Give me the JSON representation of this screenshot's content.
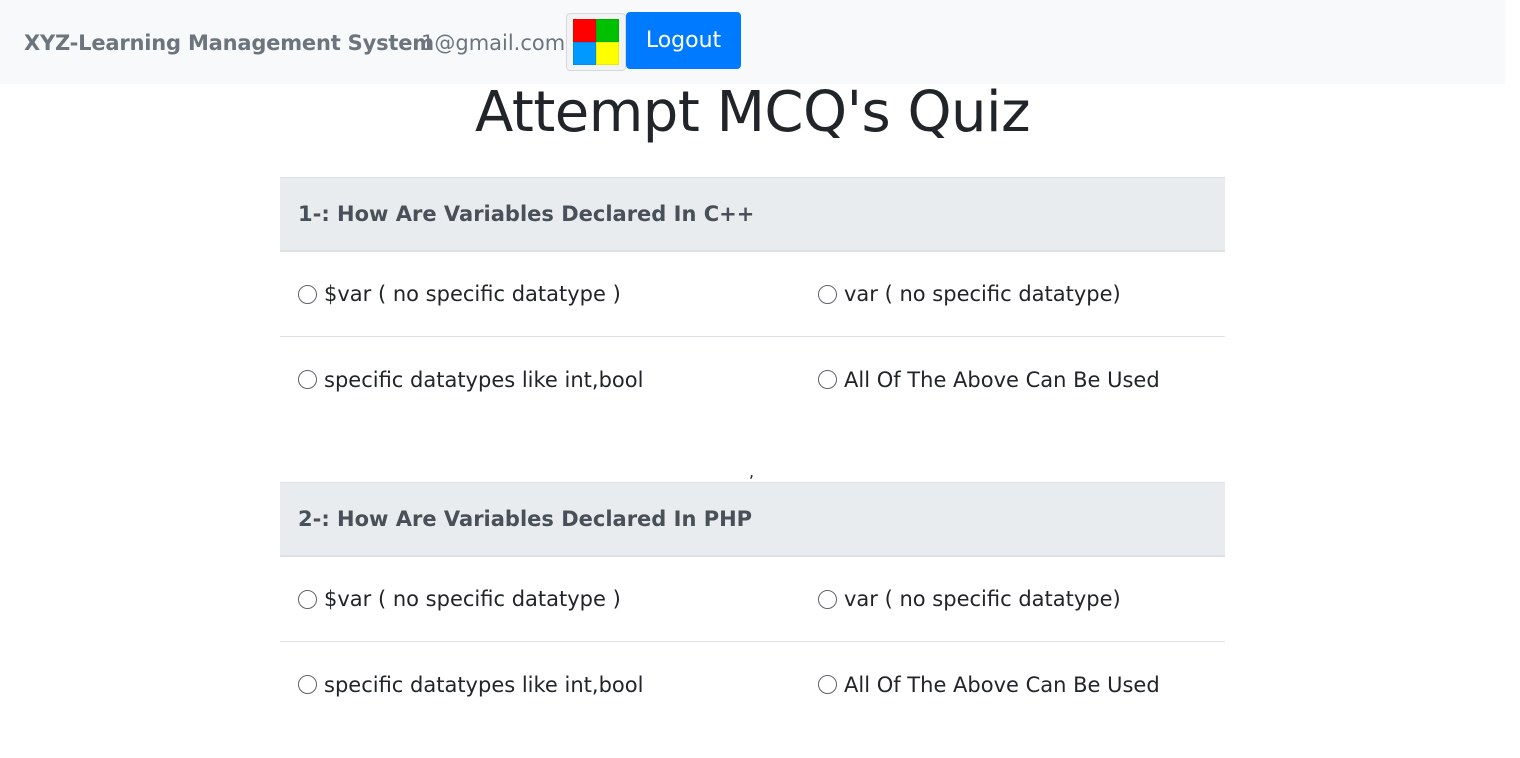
{
  "navbar": {
    "brand": "XYZ-Learning Management System",
    "user_email": "1@gmail.com",
    "logout_label": "Logout",
    "logo_colors": [
      "#ff0000",
      "#00c000",
      "#0099ff",
      "#ffff00"
    ]
  },
  "page": {
    "title": "Attempt MCQ's Quiz",
    "separator": ","
  },
  "questions": [
    {
      "title": "1-: How Are Variables Declared In C++",
      "options": [
        "$var ( no specific datatype )",
        "var ( no specific datatype)",
        "specific datatypes like int,bool",
        "All Of The Above Can Be Used"
      ]
    },
    {
      "title": "2-: How Are Variables Declared In PHP",
      "options": [
        "$var ( no specific datatype )",
        "var ( no specific datatype)",
        "specific datatypes like int,bool",
        "All Of The Above Can Be Used"
      ]
    }
  ],
  "colors": {
    "accent": "#007bff",
    "navbar_bg": "#f8f9fa",
    "question_header_bg": "#e9ecef"
  }
}
